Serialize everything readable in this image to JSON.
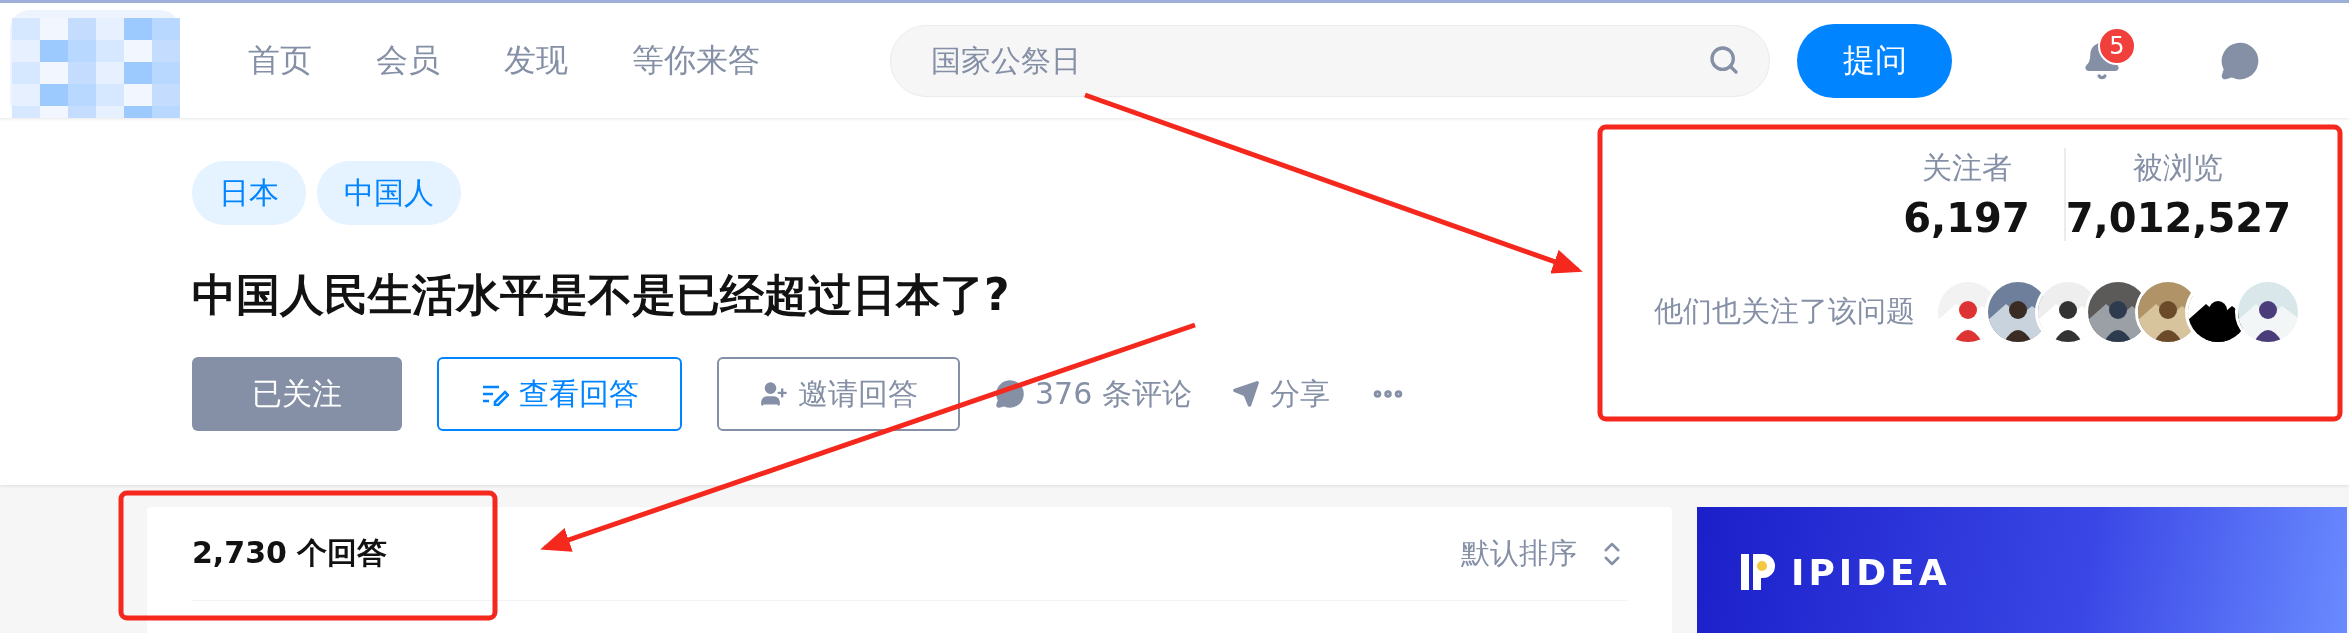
{
  "header": {
    "nav": [
      {
        "label": "首页"
      },
      {
        "label": "会员"
      },
      {
        "label": "发现"
      },
      {
        "label": "等你来答"
      }
    ],
    "search": {
      "placeholder": "国家公祭日"
    },
    "ask_button": "提问",
    "notifications_badge": "5"
  },
  "question": {
    "tags": [
      "日本",
      "中国人"
    ],
    "title": "中国人民生活水平是不是已经超过日本了?",
    "actions": [
      {
        "kind": "follow",
        "label": "已关注",
        "selected": true
      },
      {
        "kind": "view",
        "label": "查看回答"
      },
      {
        "kind": "invite",
        "label": "邀请回答"
      },
      {
        "kind": "comment",
        "label": "376 条评论"
      },
      {
        "kind": "share",
        "label": "分享"
      },
      {
        "kind": "more"
      }
    ]
  },
  "stats": [
    {
      "label": "关注者",
      "value": "6,197"
    },
    {
      "label": "被浏览",
      "value": "7,012,527"
    }
  ],
  "followers": {
    "label": "他们也关注了该问题"
  },
  "answers": {
    "count": "2,730 个回答",
    "sort": "默认排序"
  },
  "ad": {
    "brand": "IPIDEA"
  },
  "annotations": [
    {
      "kind": "box"
    },
    {
      "kind": "arrow"
    },
    {
      "kind": "box"
    },
    {
      "kind": "arrow"
    }
  ]
}
